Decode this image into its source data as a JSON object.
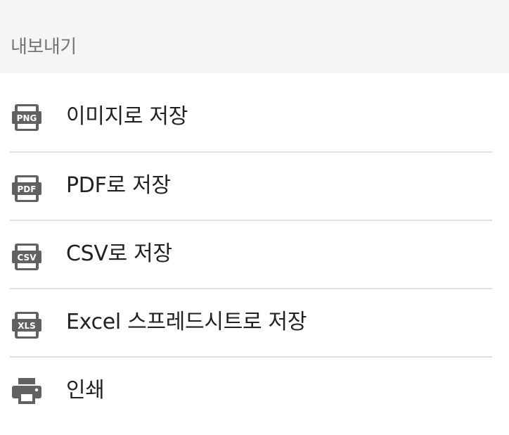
{
  "header": {
    "title": "내보내기"
  },
  "menu": {
    "items": [
      {
        "icon": "png-file-icon",
        "icon_text": "PNG",
        "label": "이미지로 저장"
      },
      {
        "icon": "pdf-file-icon",
        "icon_text": "PDF",
        "label": "PDF로 저장"
      },
      {
        "icon": "csv-file-icon",
        "icon_text": "CSV",
        "label": "CSV로 저장"
      },
      {
        "icon": "xls-file-icon",
        "icon_text": "XLS",
        "label": "Excel 스프레드시트로 저장"
      },
      {
        "icon": "printer-icon",
        "label": "인쇄"
      }
    ]
  },
  "colors": {
    "header_bg": "#f5f5f5",
    "header_text": "#757575",
    "item_text": "#212121",
    "icon": "#616161",
    "divider": "#e0e0e0"
  }
}
